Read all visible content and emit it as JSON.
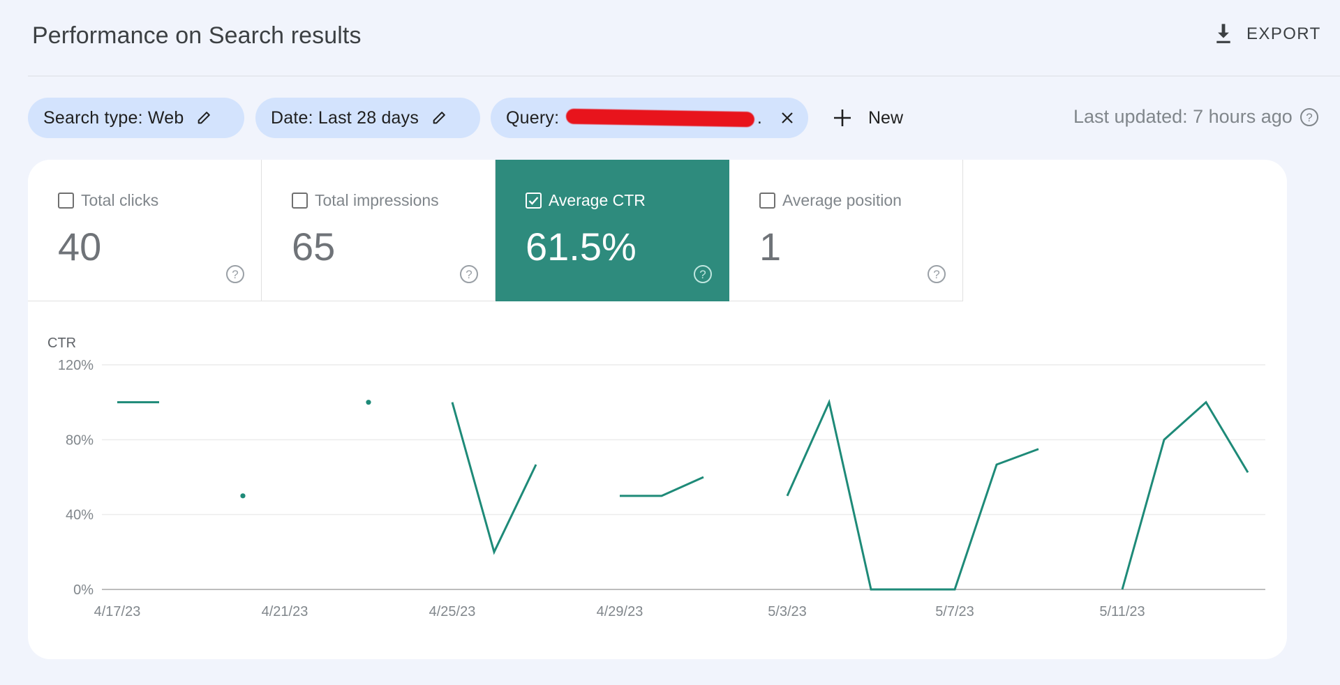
{
  "header": {
    "title": "Performance on Search results",
    "export_label": "EXPORT"
  },
  "filters": {
    "search_type": "Search type: Web",
    "date": "Date: Last 28 days",
    "query_label": "Query:",
    "query_value_redacted": true,
    "query_trailing": "."
  },
  "new_button": {
    "label": "New"
  },
  "last_updated": "Last updated: 7 hours ago",
  "metrics": [
    {
      "label": "Total clicks",
      "value": "40",
      "checked": false
    },
    {
      "label": "Total impressions",
      "value": "65",
      "checked": false
    },
    {
      "label": "Average CTR",
      "value": "61.5%",
      "checked": true
    },
    {
      "label": "Average position",
      "value": "1",
      "checked": false
    }
  ],
  "colors": {
    "accent": "#2e8b7d",
    "chip_bg": "#d3e3fd",
    "page_bg": "#f1f4fc",
    "line": "#1e8a78"
  },
  "chart_data": {
    "type": "line",
    "title": "",
    "ylabel": "CTR",
    "xlabel": "",
    "ylim": [
      0,
      120
    ],
    "yticks": [
      "0%",
      "40%",
      "80%",
      "120%"
    ],
    "ytick_values": [
      0,
      40,
      80,
      120
    ],
    "x": [
      "4/17/23",
      "4/18/23",
      "4/19/23",
      "4/20/23",
      "4/21/23",
      "4/22/23",
      "4/23/23",
      "4/24/23",
      "4/25/23",
      "4/26/23",
      "4/27/23",
      "4/28/23",
      "4/29/23",
      "4/30/23",
      "5/1/23",
      "5/2/23",
      "5/3/23",
      "5/4/23",
      "5/5/23",
      "5/6/23",
      "5/7/23",
      "5/8/23",
      "5/9/23",
      "5/10/23",
      "5/11/23",
      "5/12/23",
      "5/13/23",
      "5/14/23"
    ],
    "xtick_labels": [
      "4/17/23",
      "4/21/23",
      "4/25/23",
      "4/29/23",
      "5/3/23",
      "5/7/23",
      "5/11/23"
    ],
    "xtick_indices": [
      0,
      4,
      8,
      12,
      16,
      20,
      24
    ],
    "series": [
      {
        "name": "CTR",
        "values": [
          100,
          100,
          null,
          50,
          null,
          null,
          100,
          null,
          100,
          20,
          66.7,
          null,
          50,
          50,
          60,
          null,
          50,
          100,
          0,
          0,
          0,
          66.7,
          75,
          null,
          0,
          80,
          100,
          62.5
        ]
      }
    ],
    "grid": true,
    "legend": "none"
  }
}
